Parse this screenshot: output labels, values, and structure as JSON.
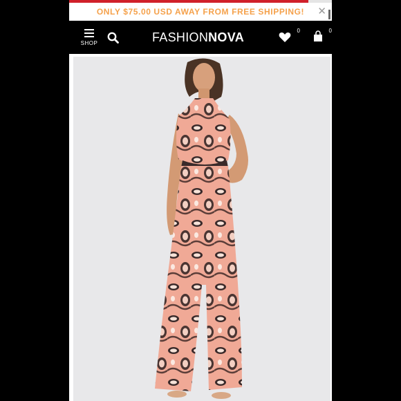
{
  "promo": {
    "text": "ONLY $75.00 USD AWAY FROM FREE SHIPPING!",
    "progress": 0.91,
    "close_icon": "close-icon",
    "accent_color": "#f5a14b",
    "progress_color": "#d0202a"
  },
  "header": {
    "menu_label": "SHOP",
    "menu_icon": "hamburger-icon",
    "search_icon": "search-icon",
    "logo_light": "FASHION",
    "logo_bold": "NOVA",
    "wishlist_icon": "heart-icon",
    "wishlist_count": "0",
    "cart_icon": "shopping-bag-icon",
    "cart_count": "0"
  },
  "product": {
    "image": "model-in-snake-print-halter-jumpsuit",
    "print_colors": [
      "#f0a996",
      "#3a2a2a",
      "#f6e2d8"
    ]
  }
}
